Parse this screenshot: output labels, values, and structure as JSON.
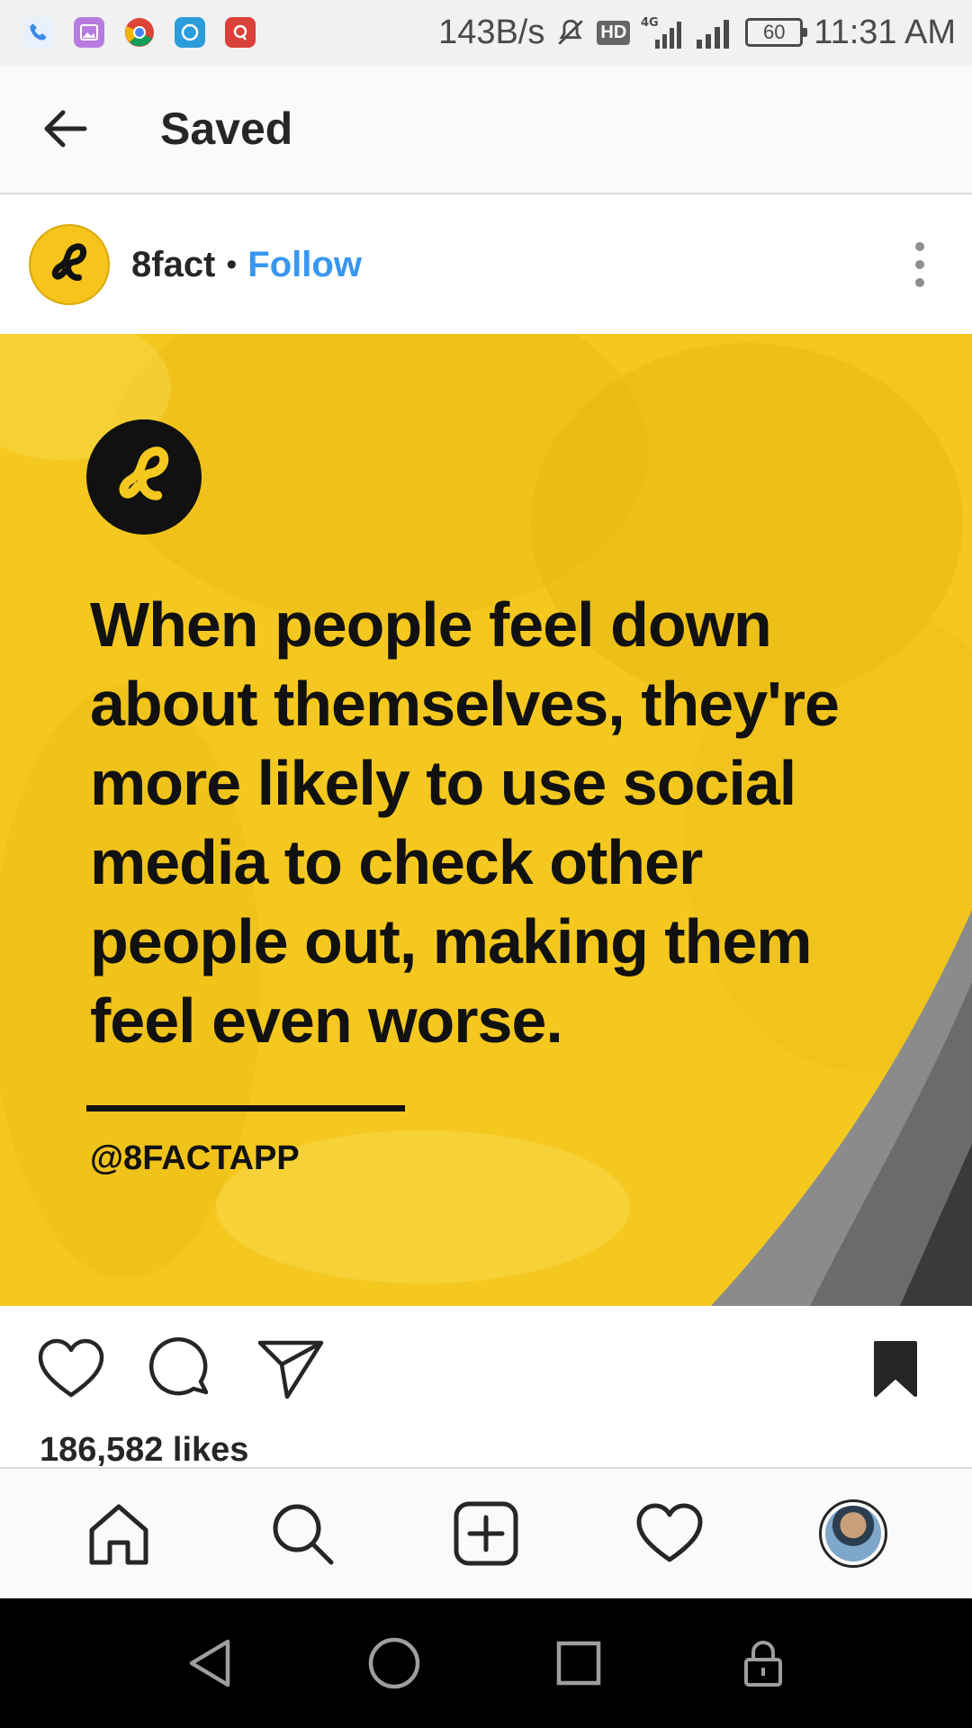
{
  "status_bar": {
    "network_speed": "143B/s",
    "network_type": "4G",
    "hd_label": "HD",
    "battery": "60",
    "time": "11:31 AM",
    "apps": [
      "phone-icon",
      "gallery-icon",
      "chrome-icon",
      "circle-app-icon",
      "quora-icon"
    ]
  },
  "header": {
    "title": "Saved",
    "back_icon": "arrow-left-icon"
  },
  "post": {
    "username": "8fact",
    "separator": "•",
    "follow_label": "Follow",
    "image": {
      "quote": "When people feel down about themselves, they're more likely to use social media to check other people out, making them feel even worse.",
      "handle": "@8FACTAPP",
      "background_color": "#f4c81f",
      "text_color": "#111111"
    },
    "likes": "186,582 likes",
    "saved": true
  },
  "tab_bar": {
    "items": [
      "home-icon",
      "search-icon",
      "add-post-icon",
      "activity-heart-icon",
      "profile-avatar"
    ]
  },
  "nav_bar": {
    "items": [
      "back-triangle-icon",
      "home-circle-icon",
      "recents-square-icon",
      "lock-icon"
    ]
  },
  "colors": {
    "link_blue": "#3897f0",
    "brand_yellow": "#f4c81f",
    "text_dark": "#262626"
  }
}
